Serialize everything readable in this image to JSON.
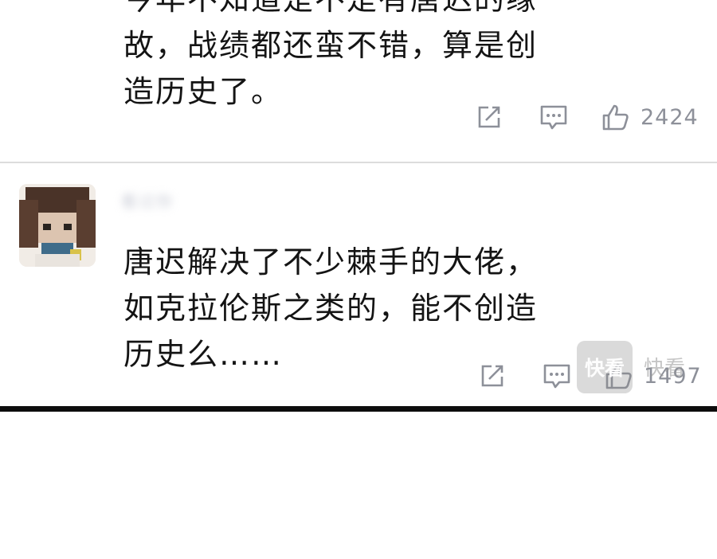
{
  "comments": [
    {
      "text_lines": [
        "今年不知道是不是有唐迟的缘",
        "故，战绩都还蛮不错，算是创",
        "造历史了。"
      ],
      "like_count": "2424",
      "icons": {
        "share": "share-icon",
        "reply": "comment-icon",
        "like": "thumbs-up-icon"
      }
    },
    {
      "username": "看过你",
      "text_lines": [
        "唐迟解决了不少棘手的大佬，",
        "如克拉伦斯之类的，能不创造",
        "历史么……"
      ],
      "like_count": "1497",
      "icons": {
        "avatar": "avatar-image",
        "share": "share-icon",
        "reply": "comment-icon",
        "like": "thumbs-up-icon"
      }
    }
  ],
  "watermark": {
    "badge": "快看",
    "text": "快看"
  },
  "colors": {
    "text": "#141414",
    "icon": "#8d9099",
    "divider": "#dcdcdc",
    "bottom_rule": "#0d0d0d"
  }
}
